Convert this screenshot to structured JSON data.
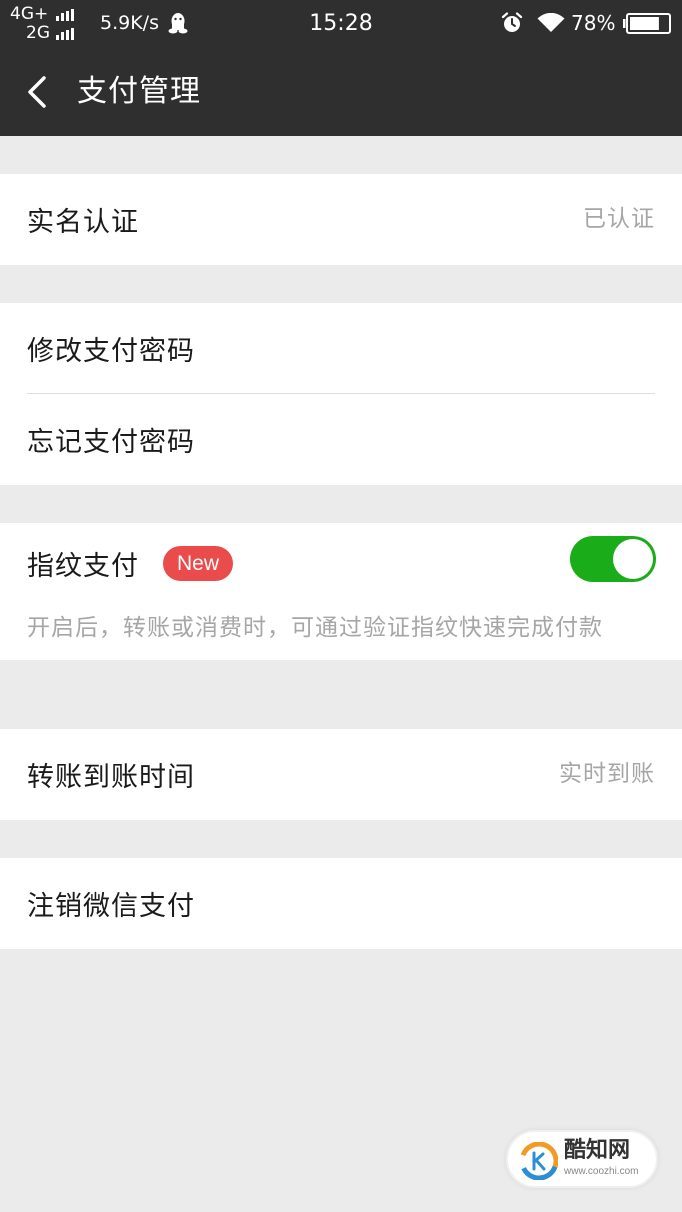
{
  "status_bar": {
    "network_top": "4G+",
    "network_bottom": "2G",
    "speed": "5.9K/s",
    "time": "15:28",
    "battery_percent": "78%",
    "battery_level": 0.78
  },
  "nav": {
    "title": "支付管理"
  },
  "sections": {
    "real_name": {
      "label": "实名认证",
      "value": "已认证"
    },
    "change_password": {
      "label": "修改支付密码"
    },
    "forgot_password": {
      "label": "忘记支付密码"
    },
    "fingerprint": {
      "label": "指纹支付",
      "badge": "New",
      "enabled": true,
      "description": "开启后，转账或消费时，可通过验证指纹快速完成付款"
    },
    "transfer_time": {
      "label": "转账到账时间",
      "value": "实时到账"
    },
    "cancel_wechat_pay": {
      "label": "注销微信支付"
    }
  },
  "watermark": {
    "name": "酷知网",
    "url": "www.coozhi.com"
  },
  "colors": {
    "header_bg": "#2f2f2f",
    "page_bg": "#ebebeb",
    "toggle_on": "#1aad19",
    "badge_red": "#ea4b4b",
    "secondary_text": "#a6a6a6"
  }
}
